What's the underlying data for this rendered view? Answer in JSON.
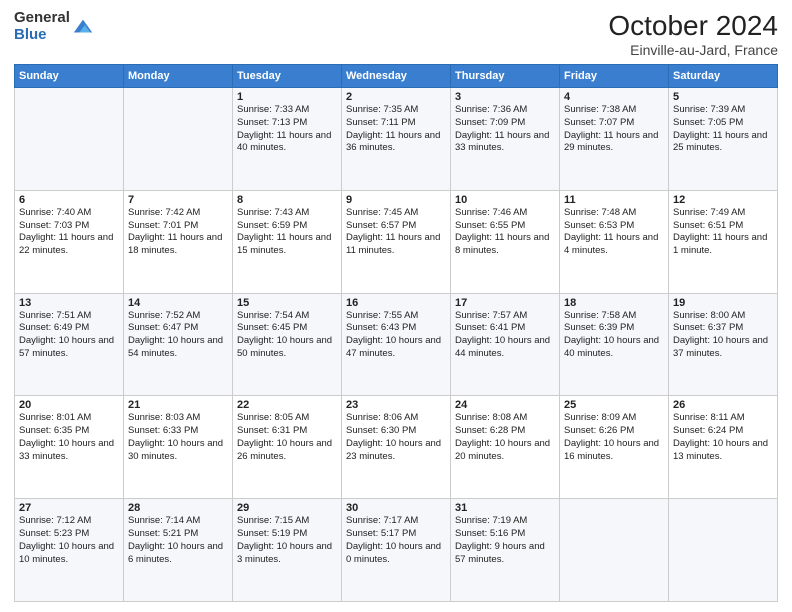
{
  "header": {
    "logo_line1": "General",
    "logo_line2": "Blue",
    "title": "October 2024",
    "subtitle": "Einville-au-Jard, France"
  },
  "calendar": {
    "days_of_week": [
      "Sunday",
      "Monday",
      "Tuesday",
      "Wednesday",
      "Thursday",
      "Friday",
      "Saturday"
    ],
    "weeks": [
      [
        {
          "day": "",
          "info": ""
        },
        {
          "day": "",
          "info": ""
        },
        {
          "day": "1",
          "info": "Sunrise: 7:33 AM\nSunset: 7:13 PM\nDaylight: 11 hours and 40 minutes."
        },
        {
          "day": "2",
          "info": "Sunrise: 7:35 AM\nSunset: 7:11 PM\nDaylight: 11 hours and 36 minutes."
        },
        {
          "day": "3",
          "info": "Sunrise: 7:36 AM\nSunset: 7:09 PM\nDaylight: 11 hours and 33 minutes."
        },
        {
          "day": "4",
          "info": "Sunrise: 7:38 AM\nSunset: 7:07 PM\nDaylight: 11 hours and 29 minutes."
        },
        {
          "day": "5",
          "info": "Sunrise: 7:39 AM\nSunset: 7:05 PM\nDaylight: 11 hours and 25 minutes."
        }
      ],
      [
        {
          "day": "6",
          "info": "Sunrise: 7:40 AM\nSunset: 7:03 PM\nDaylight: 11 hours and 22 minutes."
        },
        {
          "day": "7",
          "info": "Sunrise: 7:42 AM\nSunset: 7:01 PM\nDaylight: 11 hours and 18 minutes."
        },
        {
          "day": "8",
          "info": "Sunrise: 7:43 AM\nSunset: 6:59 PM\nDaylight: 11 hours and 15 minutes."
        },
        {
          "day": "9",
          "info": "Sunrise: 7:45 AM\nSunset: 6:57 PM\nDaylight: 11 hours and 11 minutes."
        },
        {
          "day": "10",
          "info": "Sunrise: 7:46 AM\nSunset: 6:55 PM\nDaylight: 11 hours and 8 minutes."
        },
        {
          "day": "11",
          "info": "Sunrise: 7:48 AM\nSunset: 6:53 PM\nDaylight: 11 hours and 4 minutes."
        },
        {
          "day": "12",
          "info": "Sunrise: 7:49 AM\nSunset: 6:51 PM\nDaylight: 11 hours and 1 minute."
        }
      ],
      [
        {
          "day": "13",
          "info": "Sunrise: 7:51 AM\nSunset: 6:49 PM\nDaylight: 10 hours and 57 minutes."
        },
        {
          "day": "14",
          "info": "Sunrise: 7:52 AM\nSunset: 6:47 PM\nDaylight: 10 hours and 54 minutes."
        },
        {
          "day": "15",
          "info": "Sunrise: 7:54 AM\nSunset: 6:45 PM\nDaylight: 10 hours and 50 minutes."
        },
        {
          "day": "16",
          "info": "Sunrise: 7:55 AM\nSunset: 6:43 PM\nDaylight: 10 hours and 47 minutes."
        },
        {
          "day": "17",
          "info": "Sunrise: 7:57 AM\nSunset: 6:41 PM\nDaylight: 10 hours and 44 minutes."
        },
        {
          "day": "18",
          "info": "Sunrise: 7:58 AM\nSunset: 6:39 PM\nDaylight: 10 hours and 40 minutes."
        },
        {
          "day": "19",
          "info": "Sunrise: 8:00 AM\nSunset: 6:37 PM\nDaylight: 10 hours and 37 minutes."
        }
      ],
      [
        {
          "day": "20",
          "info": "Sunrise: 8:01 AM\nSunset: 6:35 PM\nDaylight: 10 hours and 33 minutes."
        },
        {
          "day": "21",
          "info": "Sunrise: 8:03 AM\nSunset: 6:33 PM\nDaylight: 10 hours and 30 minutes."
        },
        {
          "day": "22",
          "info": "Sunrise: 8:05 AM\nSunset: 6:31 PM\nDaylight: 10 hours and 26 minutes."
        },
        {
          "day": "23",
          "info": "Sunrise: 8:06 AM\nSunset: 6:30 PM\nDaylight: 10 hours and 23 minutes."
        },
        {
          "day": "24",
          "info": "Sunrise: 8:08 AM\nSunset: 6:28 PM\nDaylight: 10 hours and 20 minutes."
        },
        {
          "day": "25",
          "info": "Sunrise: 8:09 AM\nSunset: 6:26 PM\nDaylight: 10 hours and 16 minutes."
        },
        {
          "day": "26",
          "info": "Sunrise: 8:11 AM\nSunset: 6:24 PM\nDaylight: 10 hours and 13 minutes."
        }
      ],
      [
        {
          "day": "27",
          "info": "Sunrise: 7:12 AM\nSunset: 5:23 PM\nDaylight: 10 hours and 10 minutes."
        },
        {
          "day": "28",
          "info": "Sunrise: 7:14 AM\nSunset: 5:21 PM\nDaylight: 10 hours and 6 minutes."
        },
        {
          "day": "29",
          "info": "Sunrise: 7:15 AM\nSunset: 5:19 PM\nDaylight: 10 hours and 3 minutes."
        },
        {
          "day": "30",
          "info": "Sunrise: 7:17 AM\nSunset: 5:17 PM\nDaylight: 10 hours and 0 minutes."
        },
        {
          "day": "31",
          "info": "Sunrise: 7:19 AM\nSunset: 5:16 PM\nDaylight: 9 hours and 57 minutes."
        },
        {
          "day": "",
          "info": ""
        },
        {
          "day": "",
          "info": ""
        }
      ]
    ]
  }
}
